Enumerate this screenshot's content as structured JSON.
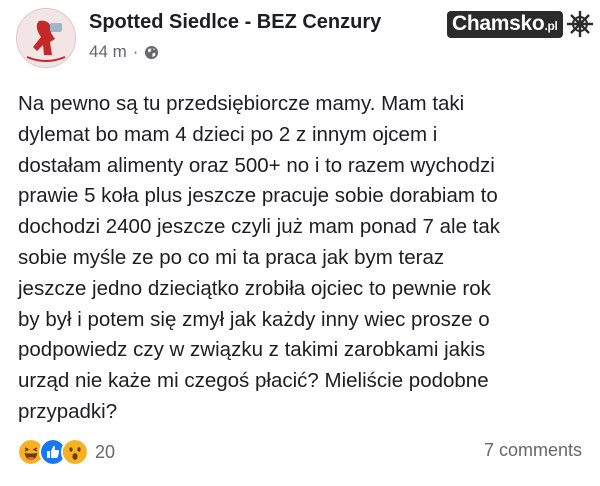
{
  "post": {
    "page_name": "Spotted Siedlce - BEZ Cenzury",
    "time": "44 m",
    "separator": "·",
    "privacy_icon": "globe-icon",
    "text_lines": [
      "Na pewno są tu przedsiębiorcze mamy. Mam taki",
      "dylemat bo mam 4 dzieci po 2 z innym ojcem i",
      "dostałam alimenty oraz 500+ no i to razem wychodzi",
      "prawie 5 koła plus jeszcze pracuje sobie dorabiam to",
      "dochodzi 2400 jeszcze czyli już mam ponad 7 ale tak",
      "sobie myśle ze po co mi ta praca jak bym teraz",
      "jeszcze jedno dzieciątko zrobiła ojciec to pewnie rok",
      "by był i potem się zmył jak każdy inny wiec prosze o",
      "podpowiedz czy w związku z takimi zarobkami jakis",
      "urząd nie każe mi czegoś płacić? Mieliście podobne",
      "przypadki?"
    ],
    "reactions": {
      "icons": [
        "haha-icon",
        "like-icon",
        "wow-icon"
      ],
      "count": "20"
    },
    "comments": "7 comments"
  },
  "watermark": {
    "brand": "Chamsko",
    "suffix": ".pl",
    "icon": "chamsko-logo-icon"
  },
  "colors": {
    "text": "#1c1e21",
    "secondary": "#65676b",
    "like": "#1877f2",
    "reaction_yellow": "#f7b125"
  }
}
